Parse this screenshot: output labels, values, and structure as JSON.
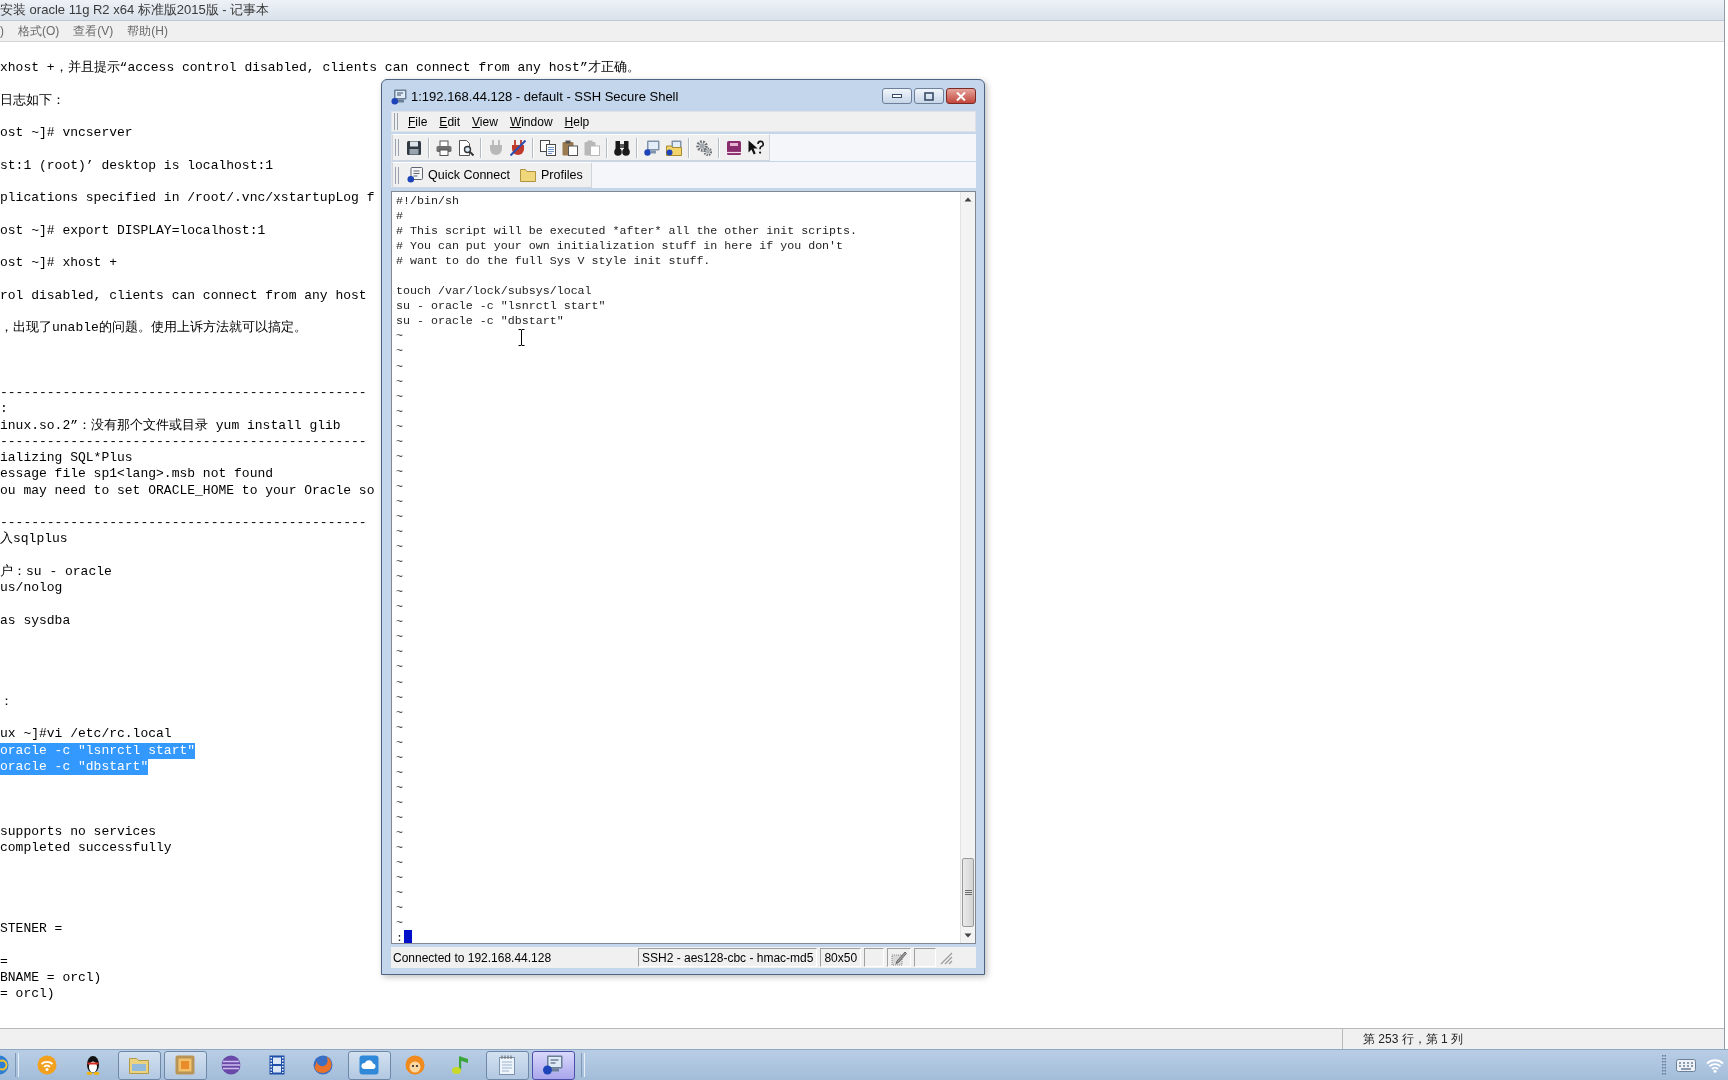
{
  "notepad": {
    "title": "安装 oracle 11g R2 x64 标准版2015版 - 记事本",
    "menu": [
      ")",
      "格式(O)",
      "查看(V)",
      "帮助(H)"
    ],
    "lines": [
      {
        "kind": "text",
        "text": "xhost +，并且提示“access control disabled, clients can connect from any host”才正确。",
        "selected": false
      },
      {
        "kind": "blank"
      },
      {
        "kind": "text",
        "text": "日志如下：",
        "selected": false
      },
      {
        "kind": "blank"
      },
      {
        "kind": "text",
        "text": "ost ~]# vncserver",
        "selected": false
      },
      {
        "kind": "blank"
      },
      {
        "kind": "text",
        "text": "st:1 (root)’ desktop is localhost:1",
        "selected": false
      },
      {
        "kind": "blank"
      },
      {
        "kind": "text",
        "text": "plications specified in /root/.vnc/xstartupLog f",
        "selected": false
      },
      {
        "kind": "blank"
      },
      {
        "kind": "text",
        "text": "ost ~]# export DISPLAY=localhost:1",
        "selected": false
      },
      {
        "kind": "blank"
      },
      {
        "kind": "text",
        "text": "ost ~]# xhost +",
        "selected": false
      },
      {
        "kind": "blank"
      },
      {
        "kind": "text",
        "text": "rol disabled, clients can connect from any host",
        "selected": false
      },
      {
        "kind": "blank"
      },
      {
        "kind": "text",
        "text": "，出现了unable的问题。使用上诉方法就可以搞定。",
        "selected": false
      },
      {
        "kind": "blank"
      },
      {
        "kind": "blank"
      },
      {
        "kind": "blank"
      },
      {
        "kind": "text",
        "text": "-----------------------------------------------",
        "selected": false
      },
      {
        "kind": "text",
        "text": ":",
        "selected": false
      },
      {
        "kind": "text",
        "text": "inux.so.2”：没有那个文件或目录 yum install glib",
        "selected": false
      },
      {
        "kind": "text",
        "text": "-----------------------------------------------",
        "selected": false
      },
      {
        "kind": "text",
        "text": "ializing SQL*Plus",
        "selected": false
      },
      {
        "kind": "text",
        "text": "essage file sp1<lang>.msb not found",
        "selected": false
      },
      {
        "kind": "text",
        "text": "ou may need to set ORACLE_HOME to your Oracle so",
        "selected": false
      },
      {
        "kind": "blank"
      },
      {
        "kind": "text",
        "text": "-----------------------------------------------",
        "selected": false
      },
      {
        "kind": "text",
        "text": "入sqlplus",
        "selected": false
      },
      {
        "kind": "blank"
      },
      {
        "kind": "text",
        "text": "户：su - oracle",
        "selected": false
      },
      {
        "kind": "text",
        "text": "us/nolog",
        "selected": false
      },
      {
        "kind": "blank"
      },
      {
        "kind": "text",
        "text": "as sysdba",
        "selected": false
      },
      {
        "kind": "blank"
      },
      {
        "kind": "blank"
      },
      {
        "kind": "blank"
      },
      {
        "kind": "blank"
      },
      {
        "kind": "text",
        "text": "：",
        "selected": false
      },
      {
        "kind": "blank"
      },
      {
        "kind": "text",
        "text": "ux ~]#vi /etc/rc.local",
        "selected": false
      },
      {
        "kind": "text",
        "text": "oracle -c \"lsnrctl start\"",
        "selected": true
      },
      {
        "kind": "text",
        "text": "oracle -c \"dbstart\"",
        "selected": true
      },
      {
        "kind": "blank"
      },
      {
        "kind": "blank"
      },
      {
        "kind": "blank"
      },
      {
        "kind": "text",
        "text": "supports no services",
        "selected": false
      },
      {
        "kind": "text",
        "text": "completed successfully",
        "selected": false
      },
      {
        "kind": "blank"
      },
      {
        "kind": "blank"
      },
      {
        "kind": "blank"
      },
      {
        "kind": "blank"
      },
      {
        "kind": "text",
        "text": "STENER =",
        "selected": false
      },
      {
        "kind": "blank"
      },
      {
        "kind": "text",
        "text": "=",
        "selected": false
      },
      {
        "kind": "text",
        "text": "BNAME = orcl)",
        "selected": false
      },
      {
        "kind": "text",
        "text": "= orcl)",
        "selected": false
      }
    ],
    "status": "第 253 行，第 1 列"
  },
  "ssh_window": {
    "title": "1:192.168.44.128 - default - SSH Secure Shell",
    "menu": [
      "File",
      "Edit",
      "View",
      "Window",
      "Help"
    ],
    "toolbar": [
      {
        "buttons": [
          {
            "disabled": false
          }
        ]
      },
      {
        "buttons": [
          {
            "disabled": false
          },
          {
            "disabled": false
          }
        ]
      },
      {
        "buttons": [
          {
            "disabled": true
          },
          {
            "disabled": false
          }
        ]
      },
      {
        "buttons": [
          {
            "disabled": false
          },
          {
            "disabled": false
          },
          {
            "disabled": true
          }
        ]
      },
      {
        "buttons": [
          {
            "disabled": false
          }
        ]
      },
      {
        "buttons": [
          {
            "disabled": false
          },
          {
            "disabled": false
          }
        ]
      },
      {
        "buttons": [
          {
            "disabled": false
          }
        ]
      },
      {
        "buttons": [
          {
            "disabled": false
          },
          {
            "disabled": false
          }
        ]
      }
    ],
    "quick_bar": [
      "Quick Connect",
      "Profiles"
    ],
    "terminal": {
      "lines": [
        {
          "kind": "text",
          "text": "#!/bin/sh"
        },
        {
          "kind": "text",
          "text": "#"
        },
        {
          "kind": "text",
          "text": "# This script will be executed *after* all the other init scripts."
        },
        {
          "kind": "text",
          "text": "# You can put your own initialization stuff in here if you don't"
        },
        {
          "kind": "text",
          "text": "# want to do the full Sys V style init stuff."
        },
        {
          "kind": "blank"
        },
        {
          "kind": "text",
          "text": "touch /var/lock/subsys/local"
        },
        {
          "kind": "text",
          "text": "su - oracle -c \"lsnrctl start\""
        },
        {
          "kind": "text",
          "text": "su - oracle -c \"dbstart\""
        },
        {
          "kind": "text",
          "text": "~"
        },
        {
          "kind": "text",
          "text": "~"
        },
        {
          "kind": "text",
          "text": "~"
        },
        {
          "kind": "text",
          "text": "~"
        },
        {
          "kind": "text",
          "text": "~"
        },
        {
          "kind": "text",
          "text": "~"
        },
        {
          "kind": "text",
          "text": "~"
        },
        {
          "kind": "text",
          "text": "~"
        },
        {
          "kind": "text",
          "text": "~"
        },
        {
          "kind": "text",
          "text": "~"
        },
        {
          "kind": "text",
          "text": "~"
        },
        {
          "kind": "text",
          "text": "~"
        },
        {
          "kind": "text",
          "text": "~"
        },
        {
          "kind": "text",
          "text": "~"
        },
        {
          "kind": "text",
          "text": "~"
        },
        {
          "kind": "text",
          "text": "~"
        },
        {
          "kind": "text",
          "text": "~"
        },
        {
          "kind": "text",
          "text": "~"
        },
        {
          "kind": "text",
          "text": "~"
        },
        {
          "kind": "text",
          "text": "~"
        },
        {
          "kind": "text",
          "text": "~"
        },
        {
          "kind": "text",
          "text": "~"
        },
        {
          "kind": "text",
          "text": "~"
        },
        {
          "kind": "text",
          "text": "~"
        },
        {
          "kind": "text",
          "text": "~"
        },
        {
          "kind": "text",
          "text": "~"
        },
        {
          "kind": "text",
          "text": "~"
        },
        {
          "kind": "text",
          "text": "~"
        },
        {
          "kind": "text",
          "text": "~"
        },
        {
          "kind": "text",
          "text": "~"
        },
        {
          "kind": "text",
          "text": "~"
        },
        {
          "kind": "text",
          "text": "~"
        },
        {
          "kind": "text",
          "text": "~"
        },
        {
          "kind": "text",
          "text": "~"
        },
        {
          "kind": "text",
          "text": "~"
        },
        {
          "kind": "text",
          "text": "~"
        },
        {
          "kind": "text",
          "text": "~"
        },
        {
          "kind": "text",
          "text": "~"
        },
        {
          "kind": "text",
          "text": "~"
        },
        {
          "kind": "text",
          "text": "~"
        },
        {
          "kind": "prompt",
          "text": ":"
        }
      ]
    },
    "status_bar": [
      "Connected to 192.168.44.128",
      "SSH2 - aes128-cbc - hmac-md5",
      "80x50"
    ]
  },
  "taskbar": {
    "apps": [
      {
        "running": false,
        "selected": false
      },
      {
        "running": false,
        "selected": false
      },
      {
        "running": true,
        "selected": false
      },
      {
        "running": true,
        "selected": false
      },
      {
        "running": false,
        "selected": false
      },
      {
        "running": false,
        "selected": false
      },
      {
        "running": false,
        "selected": false
      },
      {
        "running": true,
        "selected": false
      },
      {
        "running": false,
        "selected": false
      },
      {
        "running": false,
        "selected": false
      },
      {
        "running": true,
        "selected": false
      },
      {
        "running": true,
        "selected": true
      }
    ]
  }
}
